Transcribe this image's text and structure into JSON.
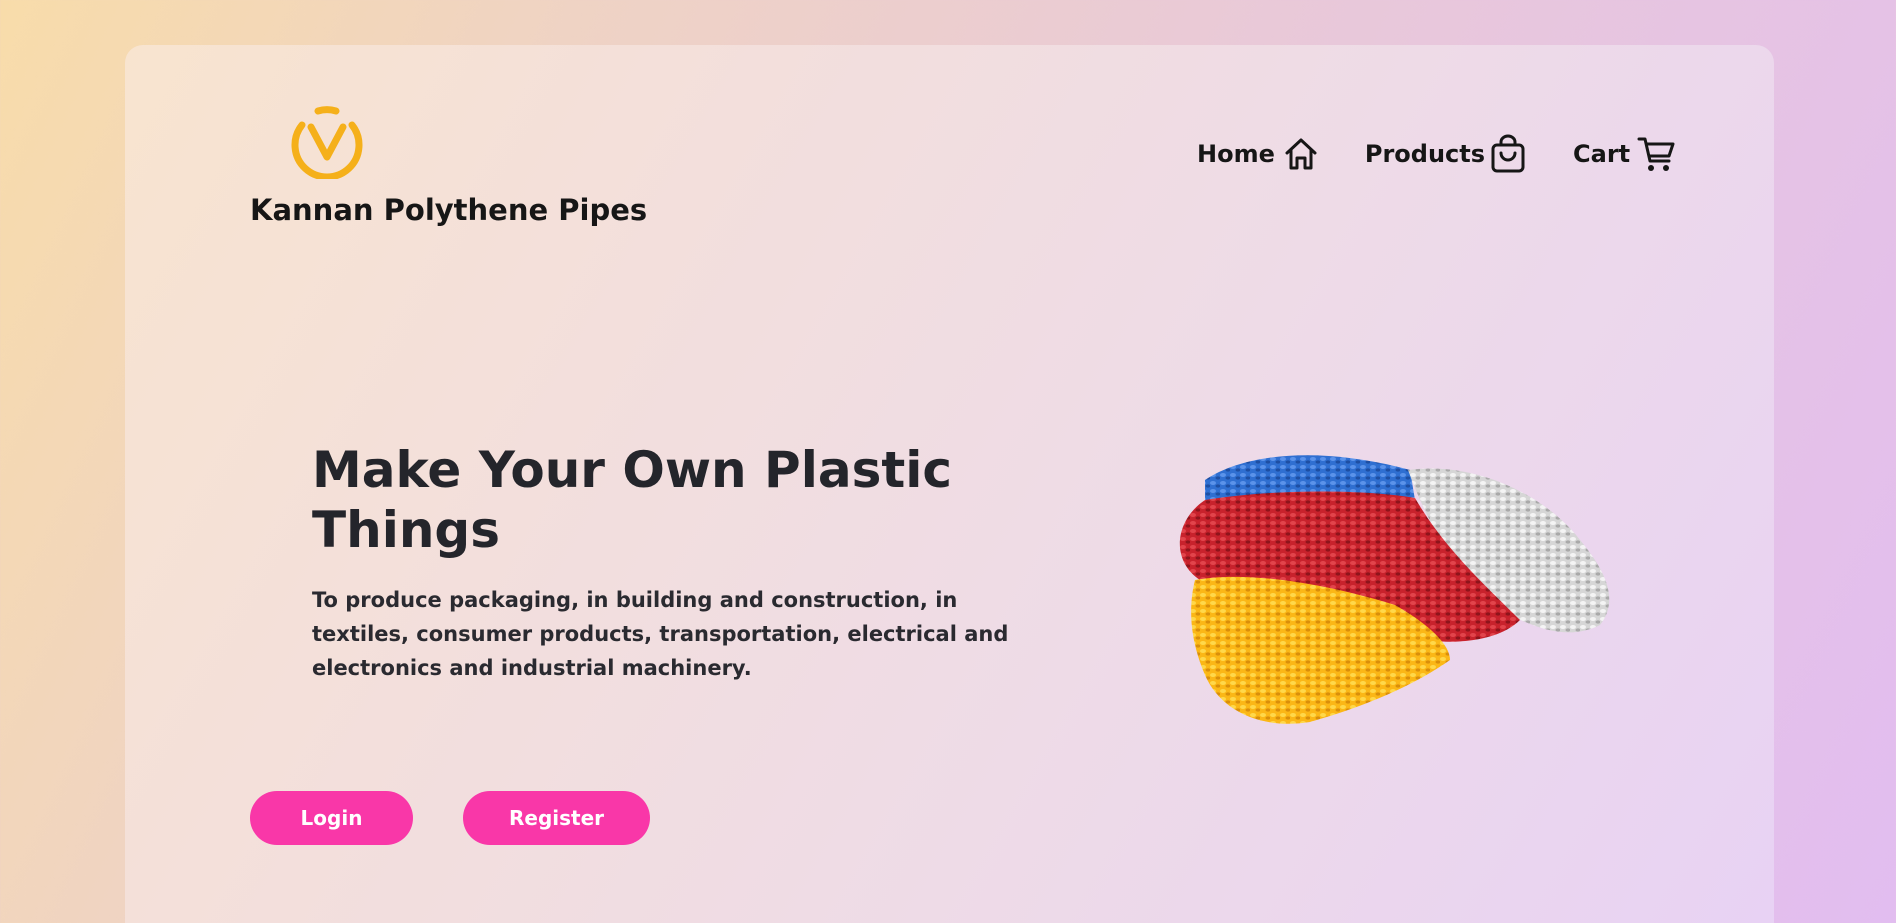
{
  "brand": {
    "name": "Kannan Polythene Pipes",
    "logo_icon": "v-circle-logo-icon",
    "logo_color": "#f5b01a"
  },
  "nav": {
    "items": [
      {
        "label": "Home",
        "icon": "home-icon"
      },
      {
        "label": "Products",
        "icon": "shopping-bag-icon"
      },
      {
        "label": "Cart",
        "icon": "cart-icon"
      }
    ]
  },
  "hero": {
    "title": "Make Your Own Plastic Things",
    "description": "To produce packaging, in building and construction, in textiles, consumer products, transportation, electrical and electronics and industrial machinery.",
    "image": "plastic-pellets-image",
    "pellet_colors": [
      "#2f6fd1",
      "#c8222c",
      "#fdc121",
      "#d9d9d9"
    ]
  },
  "buttons": {
    "login_label": "Login",
    "register_label": "Register",
    "color": "#f937a8"
  }
}
